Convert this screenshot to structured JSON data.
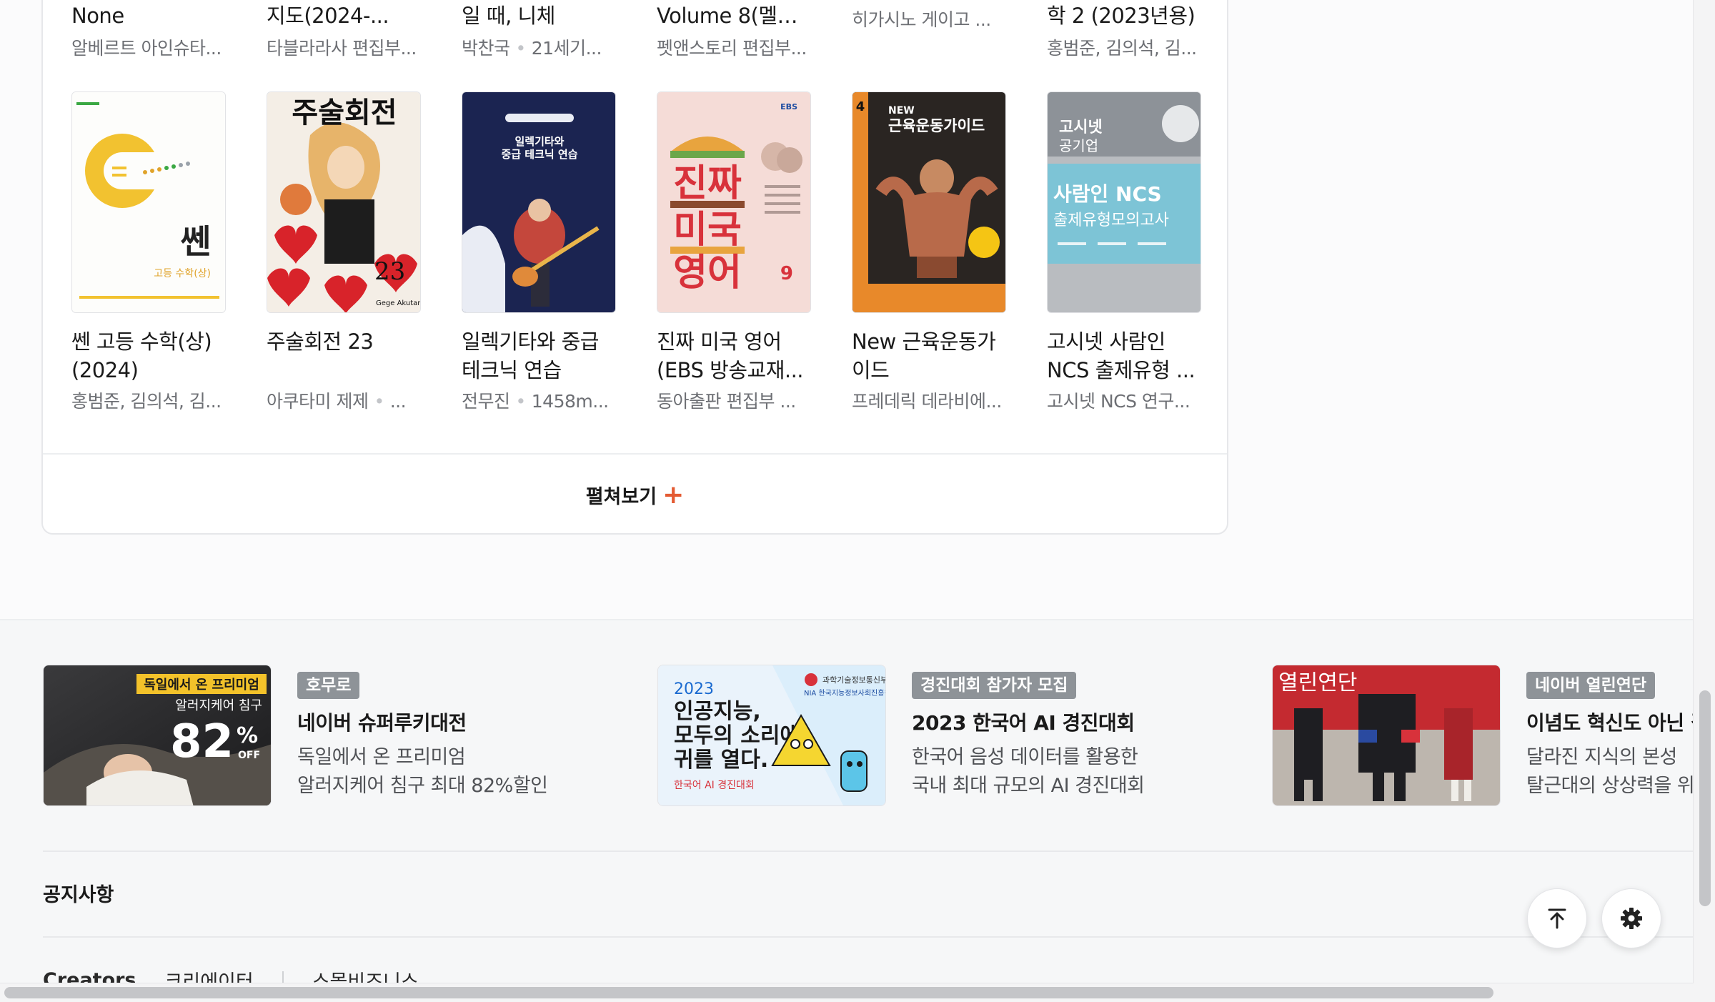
{
  "top_row": [
    {
      "title": "None",
      "meta": "알베르트 아인슈타..."
    },
    {
      "title": "지도(2024-...",
      "meta": "타블라라사 편집부..."
    },
    {
      "title": "일 때, 니체",
      "meta_author": "박찬국",
      "meta_pub": "21세기..."
    },
    {
      "title": "Volume 8(멜로...",
      "meta": "펫앤스토리 편집부..."
    },
    {
      "title": "",
      "meta": "히가시노 게이고 ..."
    },
    {
      "title": "학 2 (2023년용)",
      "meta": "홍범준, 김의석, 김..."
    }
  ],
  "books": [
    {
      "title": "쎈 고등 수학(상) (2024)",
      "meta": "홍범준, 김의석, 김...",
      "cover": {
        "brand": "쎈",
        "sub": "고등 수학(상)"
      }
    },
    {
      "title": "주술회전 23",
      "meta_author": "아쿠타미 제제",
      "meta_pub": "...",
      "cover": {
        "brand": "주술회전",
        "num": "23",
        "author": "Gege Akutami"
      }
    },
    {
      "title": "일렉기타와 중급 테크닉 연습",
      "meta_author": "전무진",
      "meta_pub": "1458m...",
      "cover": {
        "line1": "일렉기타와",
        "line2": "중급 테크닉 연습"
      }
    },
    {
      "title": "진짜 미국 영어 (EBS 방송교재...",
      "meta": "동아출판 편집부 ...",
      "cover": {
        "brand": "EBS",
        "l1": "진짜",
        "l2": "미국",
        "l3": "영어",
        "num": "9"
      }
    },
    {
      "title": "New 근육운동가이드",
      "meta": "프레데릭 데라비에...",
      "cover": {
        "new": "NEW",
        "title": "근육운동가이드",
        "num": "4"
      }
    },
    {
      "title": "고시넷 사람인 NCS 출제유형 ...",
      "meta": "고시넷 NCS 연구...",
      "cover": {
        "brand": "고시넷",
        "sub": "공기업",
        "l1": "사람인 NCS",
        "l2": "출제유형모의고사"
      }
    }
  ],
  "expand": {
    "label": "펼쳐보기",
    "plus": "+"
  },
  "promos": [
    {
      "tag": "호무로",
      "title": "네이버 슈퍼루키대전",
      "desc1": "독일에서 온 프리미엄",
      "desc2": "알러지케어 침구 최대 82%할인",
      "img": {
        "badge": "독일에서 온 프리미엄",
        "line": "알러지케어 침구",
        "pct": "82",
        "off": "OFF"
      }
    },
    {
      "tag": "경진대회 참가자 모집",
      "title": "2023 한국어 AI 경진대회",
      "desc1": "한국어 음성 데이터를 활용한",
      "desc2": "국내 최대 규모의 AI 경진대회",
      "img": {
        "year": "2023",
        "l1": "인공지능,",
        "l2": "모두의 소리에",
        "l3": "귀를 열다.",
        "foot": "한국어 AI 경진대회",
        "org1": "과학기술정보통신부",
        "org2": "NIA 한국지능정보사회진흥원"
      }
    },
    {
      "tag": "네이버 열린연단",
      "title": "이념도 혁신도 아닌 길",
      "desc1": "달라진 지식의 본성",
      "desc2": "탈근대의 상상력을 위해",
      "img": {
        "label": "열린연단"
      }
    }
  ],
  "notice": {
    "title": "공지사항"
  },
  "footer": {
    "creators": "Creators",
    "link1": "크리에이터",
    "link2": "스몰비즈니스"
  },
  "colors": {
    "accent": "#e45b33",
    "tag_bg": "#8e9398"
  }
}
